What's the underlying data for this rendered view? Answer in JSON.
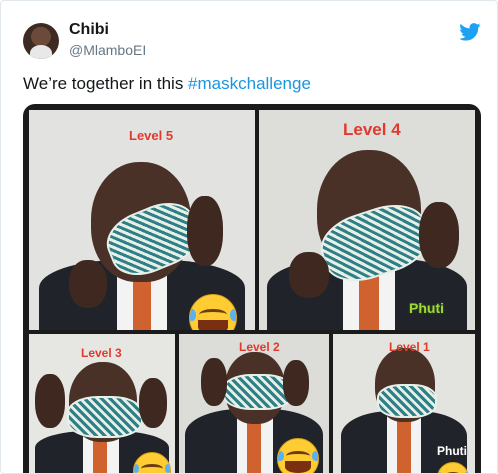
{
  "tweet": {
    "author_name": "Chibi",
    "author_handle": "@MlamboEI",
    "text_prefix": "We’re together in this ",
    "hashtag": "#maskchallenge"
  },
  "icons": {
    "platform": "twitter-bird-icon",
    "avatar": "avatar"
  },
  "colors": {
    "hashtag": "#1b95e0",
    "twitter_blue": "#1da1f2",
    "level_label": "#e03a2e",
    "watermark": "#9fd83a"
  },
  "media": {
    "panels": [
      {
        "level": "Level 5",
        "watermark": ""
      },
      {
        "level": "Level 4",
        "watermark": "Phuti"
      },
      {
        "level": "Level 3",
        "watermark": ""
      },
      {
        "level": "Level 2",
        "watermark": ""
      },
      {
        "level": "Level 1",
        "watermark": "Phuti"
      }
    ]
  }
}
